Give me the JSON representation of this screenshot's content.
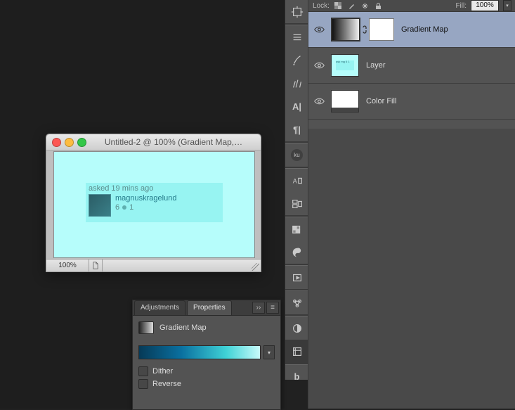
{
  "document": {
    "title": "Untitled-2 @ 100% (Gradient Map,…",
    "zoom": "100%",
    "card": {
      "asked": "asked 19 mins ago",
      "username": "magnuskragelund",
      "rep": "6",
      "badge_count": "1"
    }
  },
  "properties_panel": {
    "tab_adjustments": "Adjustments",
    "tab_properties": "Properties",
    "title": "Gradient Map",
    "dither": "Dither",
    "reverse": "Reverse"
  },
  "layers_panel": {
    "lock_label": "Lock:",
    "fill_label": "Fill:",
    "fill_value": "100%",
    "layers": {
      "l0": "Gradient Map",
      "l1": "Layer",
      "l2": "Color Fill"
    }
  }
}
